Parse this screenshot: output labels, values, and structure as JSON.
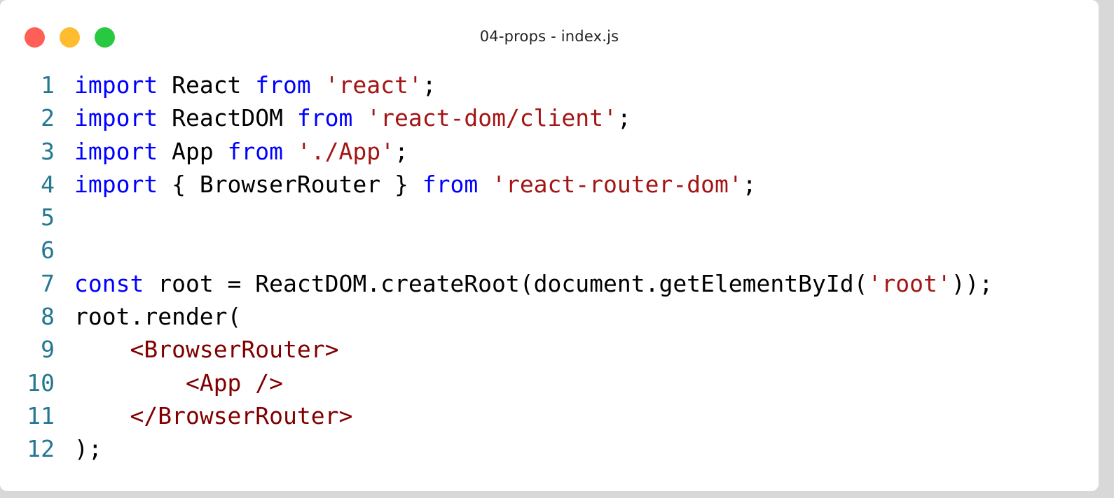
{
  "window": {
    "title": "04-props - index.js",
    "controls": [
      {
        "name": "close",
        "color": "#ff5f57"
      },
      {
        "name": "minimize",
        "color": "#febc2e"
      },
      {
        "name": "maximize",
        "color": "#28c840"
      }
    ]
  },
  "theme": {
    "keyword": "#0000ff",
    "string": "#a31515",
    "tag": "#800000",
    "text": "#000000",
    "line_number": "#237893"
  },
  "code": {
    "lines": [
      {
        "number": "1",
        "tokens": [
          {
            "t": "import",
            "k": "kw"
          },
          {
            "t": " React ",
            "k": "txt"
          },
          {
            "t": "from",
            "k": "kw"
          },
          {
            "t": " ",
            "k": "txt"
          },
          {
            "t": "'react'",
            "k": "str"
          },
          {
            "t": ";",
            "k": "txt"
          }
        ]
      },
      {
        "number": "2",
        "tokens": [
          {
            "t": "import",
            "k": "kw"
          },
          {
            "t": " ReactDOM ",
            "k": "txt"
          },
          {
            "t": "from",
            "k": "kw"
          },
          {
            "t": " ",
            "k": "txt"
          },
          {
            "t": "'react-dom/client'",
            "k": "str"
          },
          {
            "t": ";",
            "k": "txt"
          }
        ]
      },
      {
        "number": "3",
        "tokens": [
          {
            "t": "import",
            "k": "kw"
          },
          {
            "t": " App ",
            "k": "txt"
          },
          {
            "t": "from",
            "k": "kw"
          },
          {
            "t": " ",
            "k": "txt"
          },
          {
            "t": "'./App'",
            "k": "str"
          },
          {
            "t": ";",
            "k": "txt"
          }
        ]
      },
      {
        "number": "4",
        "tokens": [
          {
            "t": "import",
            "k": "kw"
          },
          {
            "t": " { BrowserRouter } ",
            "k": "txt"
          },
          {
            "t": "from",
            "k": "kw"
          },
          {
            "t": " ",
            "k": "txt"
          },
          {
            "t": "'react-router-dom'",
            "k": "str"
          },
          {
            "t": ";",
            "k": "txt"
          }
        ]
      },
      {
        "number": "5",
        "tokens": []
      },
      {
        "number": "6",
        "tokens": []
      },
      {
        "number": "7",
        "tokens": [
          {
            "t": "const",
            "k": "kw"
          },
          {
            "t": " root = ReactDOM.createRoot(document.getElementById(",
            "k": "txt"
          },
          {
            "t": "'root'",
            "k": "str"
          },
          {
            "t": "));",
            "k": "txt"
          }
        ]
      },
      {
        "number": "8",
        "tokens": [
          {
            "t": "root.render(",
            "k": "txt"
          }
        ]
      },
      {
        "number": "9",
        "tokens": [
          {
            "t": "    ",
            "k": "txt"
          },
          {
            "t": "<BrowserRouter>",
            "k": "tag"
          }
        ]
      },
      {
        "number": "10",
        "tokens": [
          {
            "t": "        ",
            "k": "txt"
          },
          {
            "t": "<App />",
            "k": "tag"
          }
        ]
      },
      {
        "number": "11",
        "tokens": [
          {
            "t": "    ",
            "k": "txt"
          },
          {
            "t": "</BrowserRouter>",
            "k": "tag"
          }
        ]
      },
      {
        "number": "12",
        "tokens": [
          {
            "t": ");",
            "k": "txt"
          }
        ]
      }
    ]
  }
}
